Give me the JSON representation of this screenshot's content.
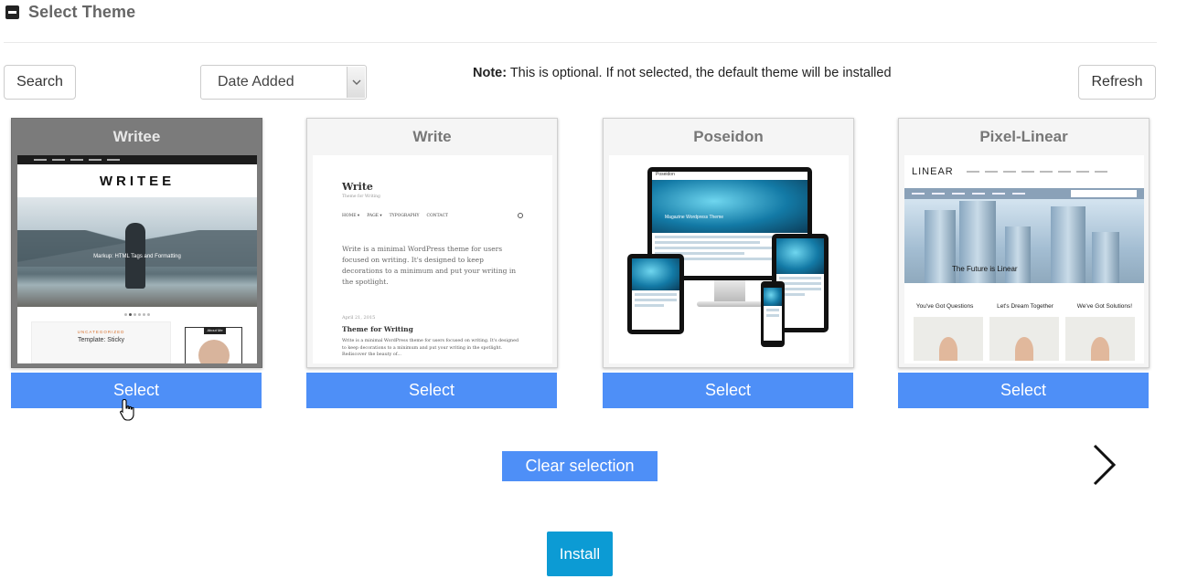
{
  "header": {
    "title": "Select Theme",
    "collapse_icon": "collapse-minus-icon"
  },
  "toolbar": {
    "search_label": "Search",
    "sort": {
      "selected": "Date Added"
    },
    "note_label": "Note:",
    "note_text": " This is optional. If not selected, the default theme will be installed",
    "refresh_label": "Refresh"
  },
  "themes": [
    {
      "name": "Writee",
      "selected": true,
      "preview": {
        "logo": "WRITEE",
        "hero_text": "Markup: HTML Tags and Formatting",
        "card_kicker": "UNCATEGORIZED",
        "card_title": "Template: Sticky",
        "side_label": "About Me"
      }
    },
    {
      "name": "Write",
      "selected": false,
      "preview": {
        "logo": "Write",
        "tagline": "Theme for Writing",
        "menu": [
          "HOME ▾",
          "PAGE ▾",
          "TYPOGRAPHY",
          "CONTACT"
        ],
        "intro": "Write is a minimal WordPress theme for users focused on writing. It's designed to keep decorations to a minimum and put your writing in the spotlight.",
        "date": "April 21, 2015",
        "post_title": "Theme for Writing",
        "post_body": "Write is a minimal WordPress theme for users focused on writing. It's designed to keep decorations to a minimum and put your writing in the spotlight. Rediscover the beauty of..."
      }
    },
    {
      "name": "Poseidon",
      "selected": false,
      "preview": {
        "site": "Poseidon",
        "hero_text": "Magazine Wordpress Theme"
      }
    },
    {
      "name": "Pixel-Linear",
      "selected": false,
      "preview": {
        "logo": "LINEAR",
        "hero_text": "The Future is Linear",
        "columns": [
          "You've Got Questions",
          "Let's Dream Together",
          "We've Got Solutions!"
        ]
      }
    }
  ],
  "select_label": "Select",
  "clear_label": "Clear selection",
  "install_label": "Install",
  "colors": {
    "primary_blue": "#4e8ff7",
    "install_blue": "#0c9bd4",
    "selected_card": "#7b7b7b"
  }
}
